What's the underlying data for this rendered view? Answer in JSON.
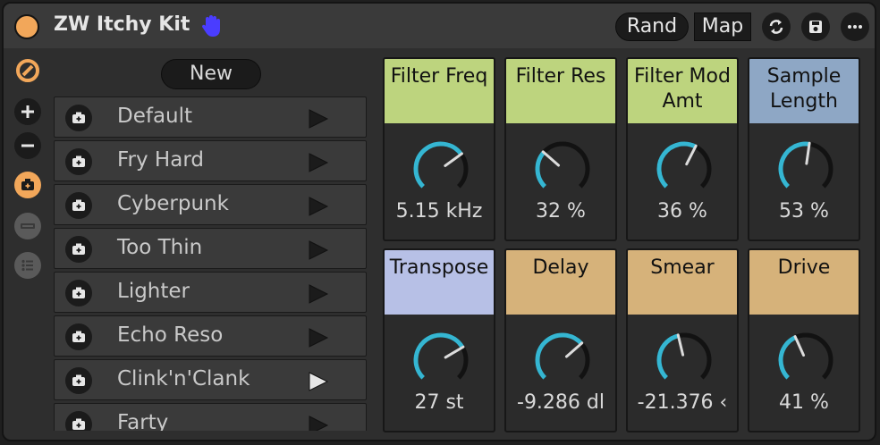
{
  "device": {
    "title": "ZW Itchy Kit",
    "buttons": {
      "rand": "Rand",
      "map": "Map"
    },
    "icons": [
      "hand-icon",
      "swap-icon",
      "save-icon",
      "more-icon"
    ]
  },
  "sidebar": {
    "icons": [
      "logo-icon",
      "plus-icon",
      "minus-icon",
      "camera-icon",
      "slot-icon",
      "list-icon"
    ]
  },
  "presets": {
    "new_label": "New",
    "items": [
      {
        "label": "Default"
      },
      {
        "label": "Fry Hard"
      },
      {
        "label": "Cyberpunk"
      },
      {
        "label": "Too Thin"
      },
      {
        "label": "Lighter"
      },
      {
        "label": "Echo Reso"
      },
      {
        "label": "Clink'n'Clank"
      },
      {
        "label": "Farty"
      }
    ]
  },
  "params": [
    {
      "name": "Filter Freq",
      "value": "5.15 kHz",
      "level": 0.7,
      "color": "#bdd47e"
    },
    {
      "name": "Filter Res",
      "value": "32 %",
      "level": 0.32,
      "color": "#bdd47e"
    },
    {
      "name": "Filter Mod Amt",
      "value": "36 %",
      "level": 0.6,
      "color": "#bdd47e"
    },
    {
      "name": "Sample Length",
      "value": "53 %",
      "level": 0.53,
      "color": "#8ea7c5"
    },
    {
      "name": "Transpose",
      "value": "27 st",
      "level": 0.72,
      "color": "#b7c0e6"
    },
    {
      "name": "Delay",
      "value": "-9.286 dl",
      "level": 0.68,
      "color": "#d6b27a"
    },
    {
      "name": "Smear",
      "value": "-21.376 ‹",
      "level": 0.45,
      "color": "#d6b27a"
    },
    {
      "name": "Drive",
      "value": "41 %",
      "level": 0.41,
      "color": "#d6b27a"
    }
  ],
  "colors": {
    "accent": "#f2a75a",
    "knob_arc": "#35b6d2",
    "hand": "#4a3dff"
  }
}
